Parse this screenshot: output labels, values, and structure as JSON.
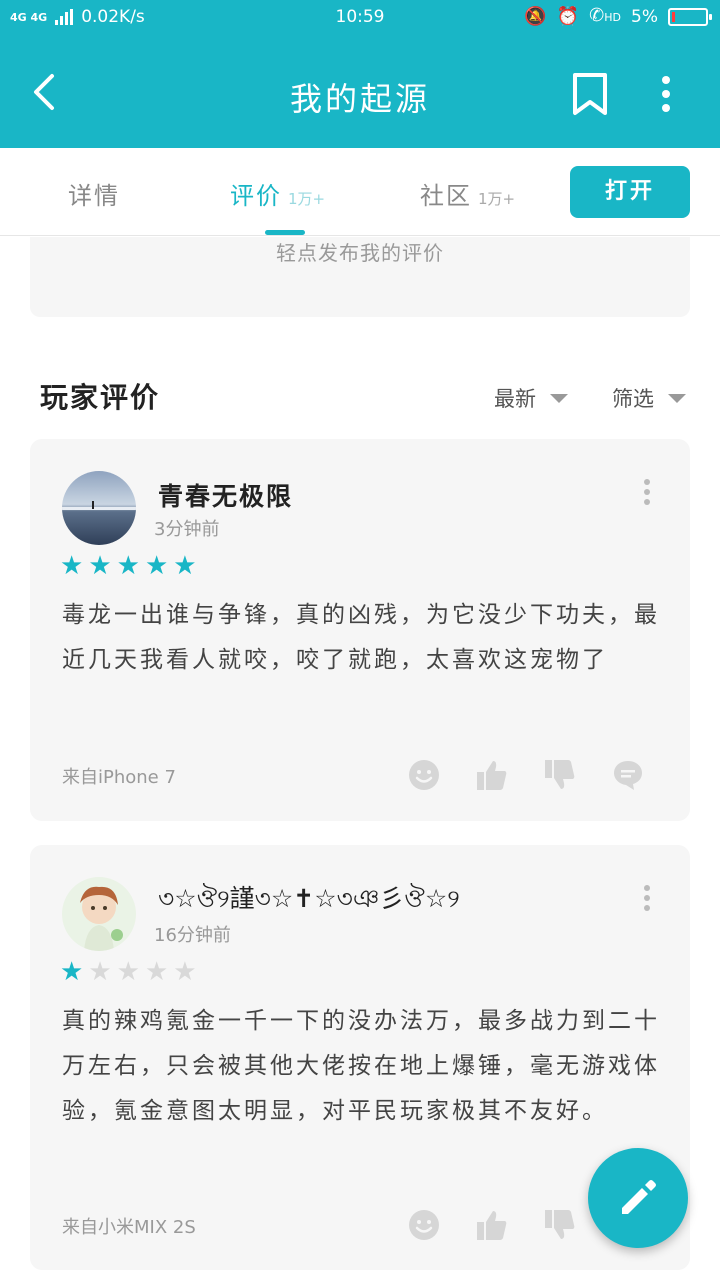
{
  "status_bar": {
    "network": "4G 4G",
    "speed": "0.02K/s",
    "time": "10:59",
    "hd": "HD",
    "battery": "5%"
  },
  "app_bar": {
    "title": "我的起源"
  },
  "tabs": [
    {
      "label": "详情",
      "count": ""
    },
    {
      "label": "评价",
      "count": "1万+"
    },
    {
      "label": "社区",
      "count": "1万+"
    }
  ],
  "open_button": "打开",
  "publish_hint": "轻点发布我的评价",
  "section": {
    "title": "玩家评价",
    "sort_label": "最新",
    "filter_label": "筛选"
  },
  "reviews": [
    {
      "name": "青春无极限",
      "time": "3分钟前",
      "rating": 5,
      "content": "毒龙一出谁与争锋，真的凶残，为它没少下功夫，最近几天我看人就咬，咬了就跑，太喜欢这宠物了",
      "device": "来自iPhone 7"
    },
    {
      "name": "৩☆ঔ୨謹৩☆✝☆৩ঞ彡ঔ☆୨",
      "time": "16分钟前",
      "rating": 1,
      "content": "真的辣鸡氪金一千一下的没办法万，最多战力到二十万左右，只会被其他大佬按在地上爆锤，毫无游戏体验，氪金意图太明显，对平民玩家极其不友好。",
      "device": "来自小米MIX 2S"
    }
  ],
  "colors": {
    "accent": "#19b6c6",
    "card_bg": "#f6f6f6",
    "icon_gray": "#d6d6d6"
  }
}
